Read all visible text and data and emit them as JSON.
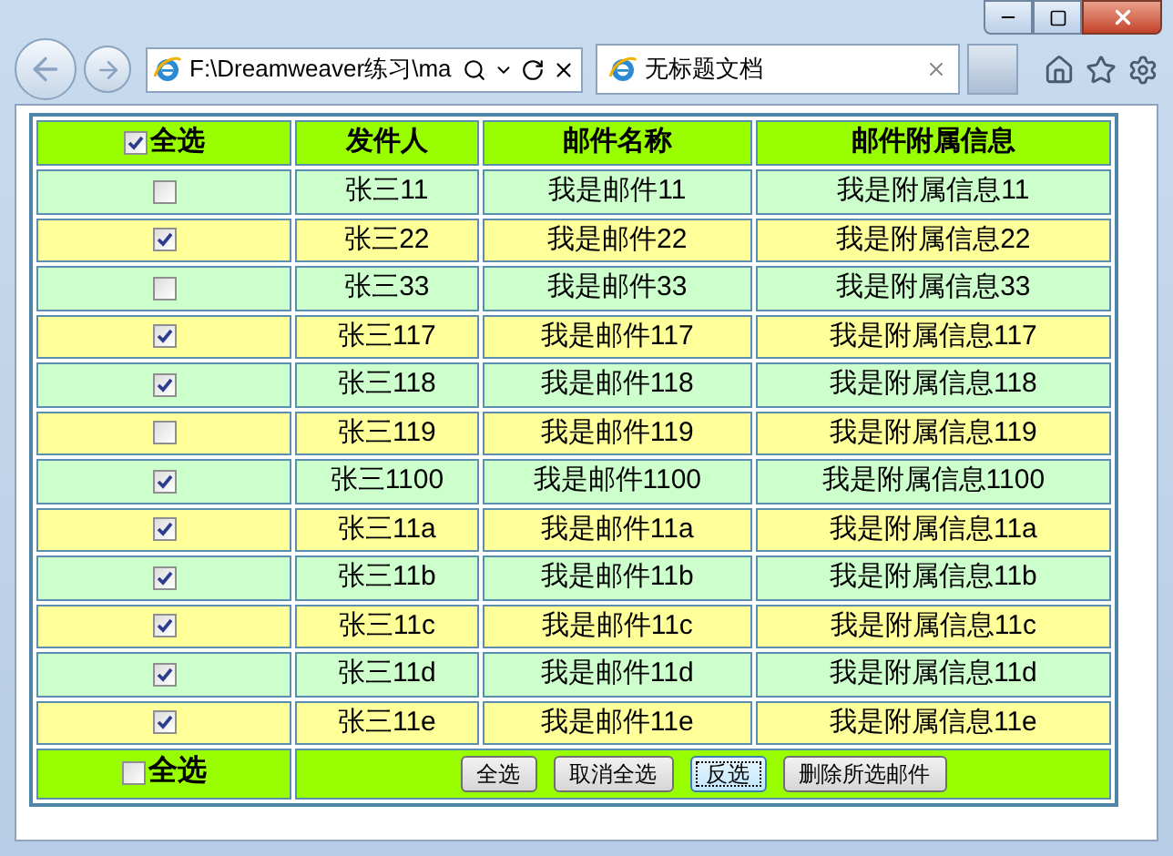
{
  "browser": {
    "address": "F:\\Dreamweaver练习\\ma",
    "tab_title": "无标题文档"
  },
  "table": {
    "header": {
      "select_all": {
        "label": "全选",
        "checked": true
      },
      "columns": [
        "发件人",
        "邮件名称",
        "邮件附属信息"
      ]
    },
    "rows": [
      {
        "checked": false,
        "color": "#ccffcc",
        "sender": "张三11",
        "name": "我是邮件11",
        "info": "我是附属信息11"
      },
      {
        "checked": true,
        "color": "#ffff99",
        "sender": "张三22",
        "name": "我是邮件22",
        "info": "我是附属信息22"
      },
      {
        "checked": false,
        "color": "#ccffcc",
        "sender": "张三33",
        "name": "我是邮件33",
        "info": "我是附属信息33"
      },
      {
        "checked": true,
        "color": "#ffff99",
        "sender": "张三117",
        "name": "我是邮件117",
        "info": "我是附属信息117"
      },
      {
        "checked": true,
        "color": "#ccffcc",
        "sender": "张三118",
        "name": "我是邮件118",
        "info": "我是附属信息118"
      },
      {
        "checked": false,
        "color": "#ffff99",
        "sender": "张三119",
        "name": "我是邮件119",
        "info": "我是附属信息119"
      },
      {
        "checked": true,
        "color": "#ccffcc",
        "sender": "张三1100",
        "name": "我是邮件1100",
        "info": "我是附属信息1100"
      },
      {
        "checked": true,
        "color": "#ffff99",
        "sender": "张三11a",
        "name": "我是邮件11a",
        "info": "我是附属信息11a"
      },
      {
        "checked": true,
        "color": "#ccffcc",
        "sender": "张三11b",
        "name": "我是邮件11b",
        "info": "我是附属信息11b"
      },
      {
        "checked": true,
        "color": "#ffff99",
        "sender": "张三11c",
        "name": "我是邮件11c",
        "info": "我是附属信息11c"
      },
      {
        "checked": true,
        "color": "#ccffcc",
        "sender": "张三11d",
        "name": "我是邮件11d",
        "info": "我是附属信息11d"
      },
      {
        "checked": true,
        "color": "#ffff99",
        "sender": "张三11e",
        "name": "我是邮件11e",
        "info": "我是附属信息11e"
      }
    ],
    "footer": {
      "select_all": {
        "label": "全选",
        "checked": false
      },
      "buttons": [
        {
          "label": "全选",
          "focused": false
        },
        {
          "label": "取消全选",
          "focused": false
        },
        {
          "label": "反选",
          "focused": true
        },
        {
          "label": "删除所选邮件",
          "focused": false
        }
      ]
    }
  }
}
